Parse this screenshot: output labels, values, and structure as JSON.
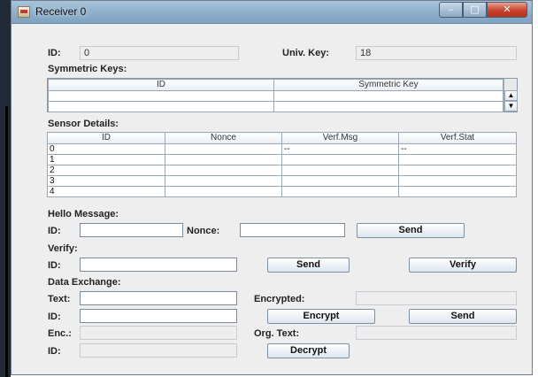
{
  "window": {
    "title": "Receiver 0",
    "controls": {
      "minimize": "–",
      "maximize": "□",
      "close": "✕"
    }
  },
  "id_label": "ID:",
  "id_value": "0",
  "univ_key_label": "Univ. Key:",
  "univ_key_value": "18",
  "symmetric_keys": {
    "heading": "Symmetric Keys:",
    "columns": [
      "ID",
      "Symmetric Key"
    ],
    "rows": [
      [
        "",
        ""
      ],
      [
        "",
        ""
      ]
    ],
    "scroll_up": "▲",
    "scroll_down": "▼"
  },
  "sensor_details": {
    "heading": "Sensor Details:",
    "columns": [
      "ID",
      "Nonce",
      "Verf.Msg",
      "Verf.Stat"
    ],
    "rows": [
      [
        "0",
        "",
        "--",
        "--"
      ],
      [
        "1",
        "",
        "",
        ""
      ],
      [
        "2",
        "",
        "",
        ""
      ],
      [
        "3",
        "",
        "",
        ""
      ],
      [
        "4",
        "",
        "",
        ""
      ]
    ]
  },
  "hello": {
    "heading": "Hello Message:",
    "id_label": "ID:",
    "id_value": "",
    "nonce_label": "Nonce:",
    "nonce_value": "",
    "send_button": "Send"
  },
  "verify": {
    "heading": "Verify:",
    "id_label": "ID:",
    "id_value": "",
    "send_button": "Send",
    "verify_button": "Verify"
  },
  "data_exchange": {
    "heading": "Data Exchange:",
    "text_label": "Text:",
    "text_value": "",
    "encrypted_label": "Encrypted:",
    "encrypted_value": "",
    "id_label": "ID:",
    "id_value": "",
    "encrypt_button": "Encrypt",
    "send_button": "Send",
    "enc_label": "Enc.:",
    "enc_value": "",
    "org_text_label": "Org. Text:",
    "org_text_value": "",
    "id2_label": "ID:",
    "id2_value": "",
    "decrypt_button": "Decrypt"
  }
}
